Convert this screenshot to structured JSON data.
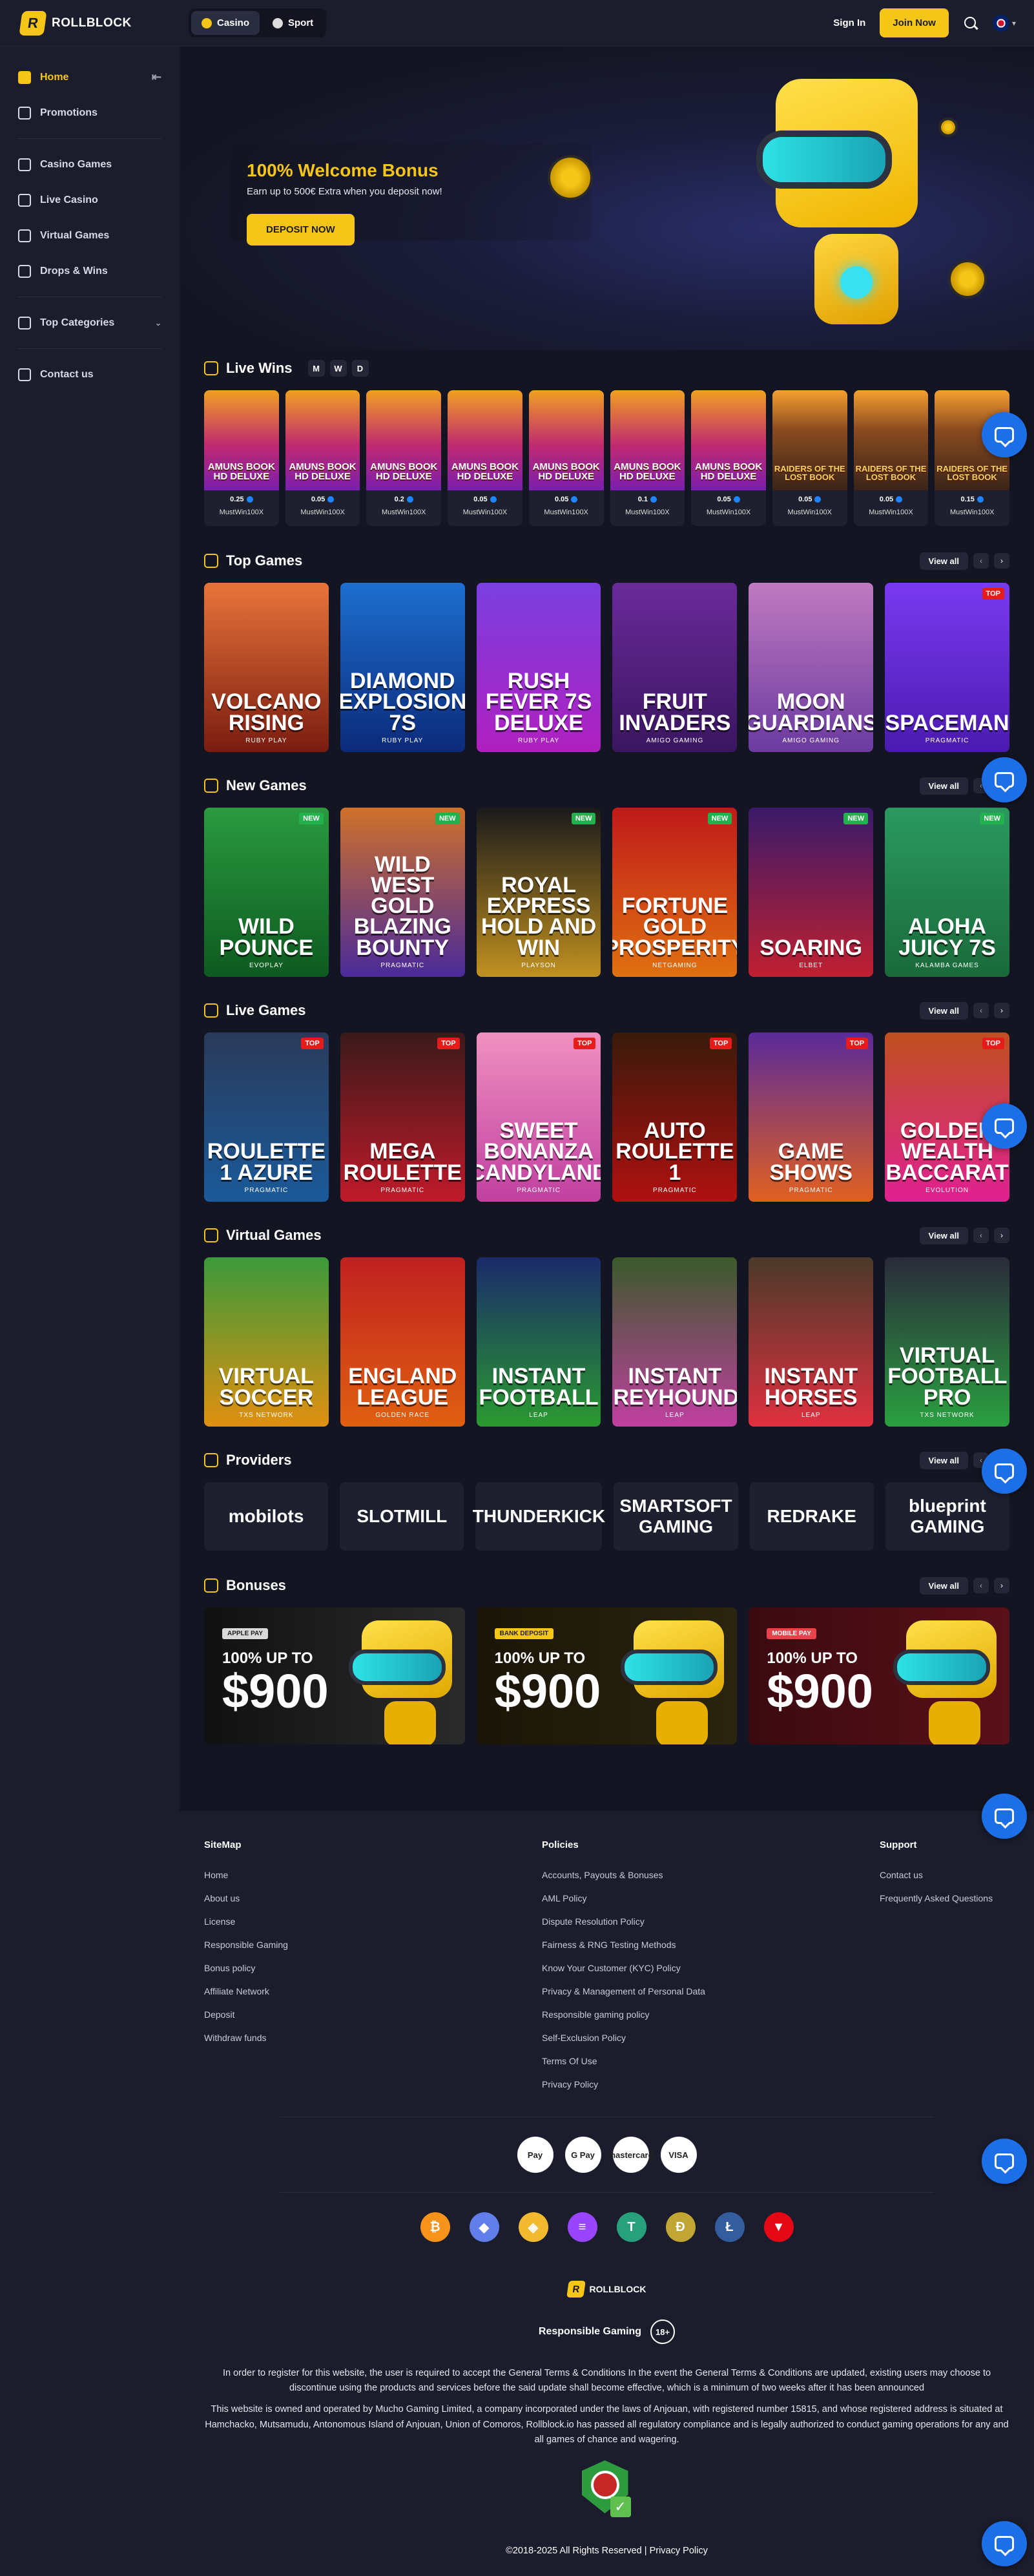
{
  "header": {
    "brand": "ROLLBLOCK",
    "tabs": [
      "Casino",
      "Sport"
    ],
    "sign_in": "Sign In",
    "join_now": "Join Now"
  },
  "sidebar": {
    "items": [
      {
        "label": "Home",
        "icon": "home-icon"
      },
      {
        "label": "Promotions",
        "icon": "gift-icon"
      },
      {
        "label": "Casino Games",
        "icon": "dice-icon"
      },
      {
        "label": "Live Casino",
        "icon": "cards-icon"
      },
      {
        "label": "Virtual Games",
        "icon": "gamepad-icon"
      },
      {
        "label": "Drops & Wins",
        "icon": "trophy-icon"
      },
      {
        "label": "Top Categories",
        "icon": "crown-icon"
      },
      {
        "label": "Contact us",
        "icon": "chat-icon"
      }
    ]
  },
  "hero": {
    "title": "100% Welcome Bonus",
    "subtitle": "Earn up to 500€ Extra when you deposit now!",
    "cta": "DEPOSIT NOW"
  },
  "live_wins": {
    "title": "Live Wins",
    "periods": [
      "M",
      "W",
      "D"
    ],
    "items": [
      {
        "game": "AMUNS BOOK HD DELUXE",
        "amount": "0.25",
        "user": "MustWin100X"
      },
      {
        "game": "AMUNS BOOK HD DELUXE",
        "amount": "0.05",
        "user": "MustWin100X"
      },
      {
        "game": "AMUNS BOOK HD DELUXE",
        "amount": "0.2",
        "user": "MustWin100X"
      },
      {
        "game": "AMUNS BOOK HD DELUXE",
        "amount": "0.05",
        "user": "MustWin100X"
      },
      {
        "game": "AMUNS BOOK HD DELUXE",
        "amount": "0.05",
        "user": "MustWin100X"
      },
      {
        "game": "AMUNS BOOK HD DELUXE",
        "amount": "0.1",
        "user": "MustWin100X"
      },
      {
        "game": "AMUNS BOOK HD DELUXE",
        "amount": "0.05",
        "user": "MustWin100X"
      },
      {
        "game": "RAIDERS OF THE LOST BOOK",
        "amount": "0.05",
        "user": "MustWin100X"
      },
      {
        "game": "RAIDERS OF THE LOST BOOK",
        "amount": "0.05",
        "user": "MustWin100X"
      },
      {
        "game": "RAIDERS OF THE LOST BOOK",
        "amount": "0.15",
        "user": "MustWin100X"
      }
    ]
  },
  "view_all": "View all",
  "top_games": {
    "title": "Top Games",
    "items": [
      {
        "name": "Volcano Rising",
        "provider": "RUBY PLAY",
        "badge": "",
        "bg": "linear-gradient(180deg,#e8743a,#7a1c10)"
      },
      {
        "name": "Diamond Explosion 7s",
        "provider": "RUBY PLAY",
        "badge": "",
        "bg": "linear-gradient(180deg,#1d6fd0,#0b2a7a)"
      },
      {
        "name": "Rush Fever 7s Deluxe",
        "provider": "RUBY PLAY",
        "badge": "",
        "bg": "linear-gradient(180deg,#7b3fe0,#b020c0)"
      },
      {
        "name": "Fruit Invaders",
        "provider": "AMIGO GAMING",
        "badge": "",
        "bg": "linear-gradient(180deg,#6a2a9a,#3a1660)"
      },
      {
        "name": "Moon Guardians",
        "provider": "AMIGO GAMING",
        "badge": "",
        "bg": "linear-gradient(180deg,#c07ac0,#6a3aa0)"
      },
      {
        "name": "Spaceman",
        "provider": "PRAGMATIC",
        "badge": "TOP",
        "bg": "linear-gradient(180deg,#7a3af0,#4a1ab0)"
      }
    ]
  },
  "new_games": {
    "title": "New Games",
    "items": [
      {
        "name": "Wild Pounce",
        "provider": "EVOPLAY",
        "badge": "NEW",
        "bg": "linear-gradient(180deg,#2a9a40,#0e5a20)"
      },
      {
        "name": "Wild West Gold Blazing Bounty",
        "provider": "PRAGMATIC",
        "badge": "NEW",
        "bg": "linear-gradient(180deg,#d0702a,#4a2a9a)"
      },
      {
        "name": "Royal Express Hold and Win",
        "provider": "PLAYSON",
        "badge": "NEW",
        "bg": "linear-gradient(180deg,#1a1a1a,#c09020)"
      },
      {
        "name": "Fortune Gold Prosperity",
        "provider": "NETGAMING",
        "badge": "NEW",
        "bg": "linear-gradient(180deg,#c01a1a,#e07010)"
      },
      {
        "name": "Soaring",
        "provider": "ELBET",
        "badge": "NEW",
        "bg": "linear-gradient(180deg,#3a1a6a,#c02030)"
      },
      {
        "name": "Aloha Juicy 7s",
        "provider": "KALAMBA GAMES",
        "badge": "NEW",
        "bg": "linear-gradient(180deg,#2a9a60,#1a6a3a)"
      }
    ]
  },
  "live_games": {
    "title": "Live Games",
    "items": [
      {
        "name": "Roulette 1 Azure",
        "provider": "PRAGMATIC",
        "badge": "TOP",
        "bg": "linear-gradient(180deg,#2a3a5a,#1a5a9a)"
      },
      {
        "name": "Mega Roulette",
        "provider": "PRAGMATIC",
        "badge": "TOP",
        "bg": "linear-gradient(180deg,#3a1a1a,#c01a2a)"
      },
      {
        "name": "Sweet Bonanza Candyland",
        "provider": "PRAGMATIC",
        "badge": "TOP",
        "bg": "linear-gradient(180deg,#f090c0,#c040a0)"
      },
      {
        "name": "Auto Roulette 1",
        "provider": "PRAGMATIC",
        "badge": "TOP",
        "bg": "linear-gradient(180deg,#3a1a0a,#b01010)"
      },
      {
        "name": "Game Shows",
        "provider": "PRAGMATIC",
        "badge": "TOP",
        "bg": "linear-gradient(180deg,#5a2a9a,#e06020)"
      },
      {
        "name": "Golden Wealth Baccarat",
        "provider": "EVOLUTION",
        "badge": "TOP",
        "bg": "linear-gradient(180deg,#c05020,#e02090)"
      }
    ]
  },
  "virtual_games": {
    "title": "Virtual Games",
    "items": [
      {
        "name": "Virtual Soccer",
        "provider": "TXS NETWORK",
        "badge": "",
        "bg": "linear-gradient(180deg,#3a9a3a,#e09010)"
      },
      {
        "name": "England League",
        "provider": "GOLDEN RACE",
        "badge": "",
        "bg": "linear-gradient(180deg,#c02020,#e06010)"
      },
      {
        "name": "Instant Football",
        "provider": "LEAP",
        "badge": "",
        "bg": "linear-gradient(180deg,#1a2a6a,#2a9a30)"
      },
      {
        "name": "Instant Greyhounds",
        "provider": "LEAP",
        "badge": "",
        "bg": "linear-gradient(180deg,#3a5a2a,#c040a0)"
      },
      {
        "name": "Instant Horses",
        "provider": "LEAP",
        "badge": "",
        "bg": "linear-gradient(180deg,#4a3a2a,#e03040)"
      },
      {
        "name": "Virtual Football Pro",
        "provider": "TXS NETWORK",
        "badge": "",
        "bg": "linear-gradient(180deg,#2a2a3a,#2aa040)"
      }
    ]
  },
  "providers": {
    "title": "Providers",
    "items": [
      "mobilots",
      "SLOTMILL",
      "THUNDERKICK",
      "SMARTSOFT GAMING",
      "REDRAKE",
      "blueprint GAMING"
    ]
  },
  "bonuses": {
    "title": "Bonuses",
    "items": [
      {
        "tag": "APPLE PAY",
        "line1": "100% UP TO",
        "amount": "$900",
        "tag_bg": "#d9d9d9",
        "tag_fg": "#222",
        "bg": "linear-gradient(90deg,#111,#2a2a2a)"
      },
      {
        "tag": "BANK DEPOSIT",
        "line1": "100% UP TO",
        "amount": "$900",
        "tag_bg": "#f5c518",
        "tag_fg": "#222",
        "bg": "linear-gradient(90deg,#1a1506,#2a2410)"
      },
      {
        "tag": "MOBILE PAY",
        "line1": "100% UP TO",
        "amount": "$900",
        "tag_bg": "#e8424a",
        "tag_fg": "#fff",
        "bg": "linear-gradient(90deg,#3a0a10,#5a1018)"
      }
    ]
  },
  "footer": {
    "sitemap": {
      "title": "SiteMap",
      "links": [
        "Home",
        "About us",
        "License",
        "Responsible Gaming",
        "Bonus policy",
        "Affiliate Network",
        "Deposit",
        "Withdraw funds"
      ]
    },
    "policies": {
      "title": "Policies",
      "links": [
        "Accounts, Payouts & Bonuses",
        "AML Policy",
        "Dispute Resolution Policy",
        "Fairness & RNG Testing Methods",
        "Know Your Customer (KYC) Policy",
        "Privacy & Management of Personal Data",
        "Responsible gaming policy",
        "Self-Exclusion Policy",
        "Terms Of Use",
        "Privacy Policy"
      ]
    },
    "support": {
      "title": "Support",
      "links": [
        "Contact us",
        "Frequently Asked Questions"
      ]
    },
    "payments": [
      "Pay",
      "G Pay",
      "mastercard",
      "VISA"
    ],
    "crypto": [
      {
        "sym": "₿",
        "color": "#f7931a"
      },
      {
        "sym": "◆",
        "color": "#627eea"
      },
      {
        "sym": "◈",
        "color": "#f3ba2f"
      },
      {
        "sym": "≡",
        "color": "#9945ff"
      },
      {
        "sym": "T",
        "color": "#26a17b"
      },
      {
        "sym": "Ð",
        "color": "#c2a633"
      },
      {
        "sym": "Ł",
        "color": "#345d9d"
      },
      {
        "sym": "▼",
        "color": "#e50915"
      }
    ],
    "brand": "ROLLBLOCK",
    "responsible": "Responsible Gaming",
    "age": "18+",
    "legal1": "In order to register for this website, the user is required to accept the General Terms & Conditions In the event the General Terms & Conditions are updated, existing users may choose to discontinue using the products and services before the said update shall become effective, which is a minimum of two weeks after it has been announced",
    "legal2": "This website is owned and operated by Mucho Gaming Limited, a company incorporated under the laws of Anjouan, with registered number 15815, and whose registered address is situated at Hamchacko, Mutsamudu, Antonomous Island of Anjouan, Union of Comoros, Rollblock.io has passed all regulatory compliance and is legally authorized to conduct gaming operations for any and all games of chance and wagering.",
    "copyright": "©2018-2025 All Rights Reserved |",
    "privacy": "Privacy Policy"
  }
}
